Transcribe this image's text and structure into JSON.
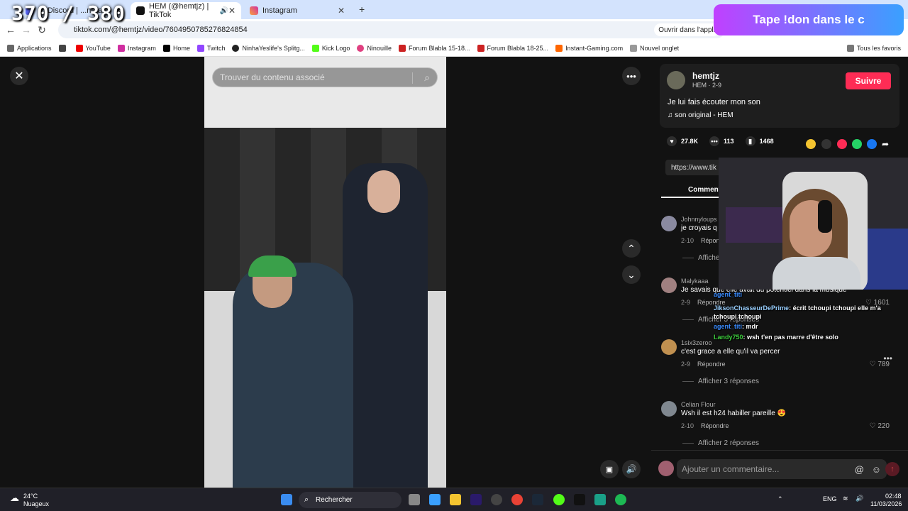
{
  "browser": {
    "tabs": [
      {
        "title": "0) Discord | ...néral |",
        "active": false
      },
      {
        "title": "HEM (@hemtjz) | TikTok",
        "active": true
      },
      {
        "title": "Instagram",
        "active": false
      }
    ],
    "url": "tiktok.com/@hemtjz/video/7604950785276824854",
    "open_app": "Ouvrir dans l'appli",
    "bookmarks": [
      "Applications",
      "YouTube",
      "Instagram",
      "Home",
      "Twitch",
      "NinhaYeslife's Splitg...",
      "Kick Logo",
      "Ninouille",
      "Forum Blabla 15-18...",
      "Forum Blabla 18-25...",
      "Instant-Gaming.com",
      "Nouvel onglet"
    ],
    "all_bookmarks": "Tous les favoris"
  },
  "overlay": {
    "counter": "370 / 380",
    "donation_text": "Tape !don dans le c"
  },
  "video": {
    "search_placeholder": "Trouver du contenu associé"
  },
  "post": {
    "username": "hemtjz",
    "subline": "HEM · 2-9",
    "follow_label": "Suivre",
    "caption": "Je lui fais écouter mon son",
    "sound": "son original - HEM",
    "likes": "27.8K",
    "comments": "113",
    "saves": "1468",
    "link_text": "https://www.tik",
    "comments_tab": "Comment"
  },
  "comments": [
    {
      "user": "Johnnyloups",
      "text": "je croyais q",
      "date": "2-10",
      "reply": "Répon",
      "likes": "",
      "more": "Affiche"
    },
    {
      "user": "Malykaaa",
      "text": "Je savais que elle avait du potentiel dans la musique",
      "date": "2-9",
      "reply": "Répondre",
      "likes": "1601",
      "more": "Afficher 5 réponses"
    },
    {
      "user": "1six3zeroo",
      "text": "c'est grace a elle qu'il va percer",
      "date": "2-9",
      "reply": "Répondre",
      "likes": "789",
      "more": "Afficher 3 réponses"
    },
    {
      "user": "Celian Flour",
      "text": "Wsh il est h24 habiller pareille 😍",
      "date": "2-10",
      "reply": "Répondre",
      "likes": "220",
      "more": "Afficher 2 réponses"
    }
  ],
  "chat": [
    {
      "user": "agent_titi",
      "msg": "",
      "color": "#3a8cff"
    },
    {
      "user": "JiksonChasseurDePrime",
      "msg": "écrit tchoupi tchoupi elle m'a tchoupi tchoupi",
      "color": "#9ad0ff"
    },
    {
      "user": "agent_titi",
      "msg": "mdr",
      "color": "#3a8cff"
    },
    {
      "user": "Landy750",
      "msg": "wsh t'en pas marre d'être solo",
      "color": "#3ecf3e"
    }
  ],
  "comment_input_placeholder": "Ajouter un commentaire...",
  "taskbar": {
    "temp": "24°C",
    "weather": "Nuageux",
    "search": "Rechercher",
    "lang": "ENG",
    "time": "02:48",
    "date": "11/03/2026"
  },
  "colors": {
    "accent": "#fe2c55",
    "tab_bar": "#d3e3fd"
  }
}
